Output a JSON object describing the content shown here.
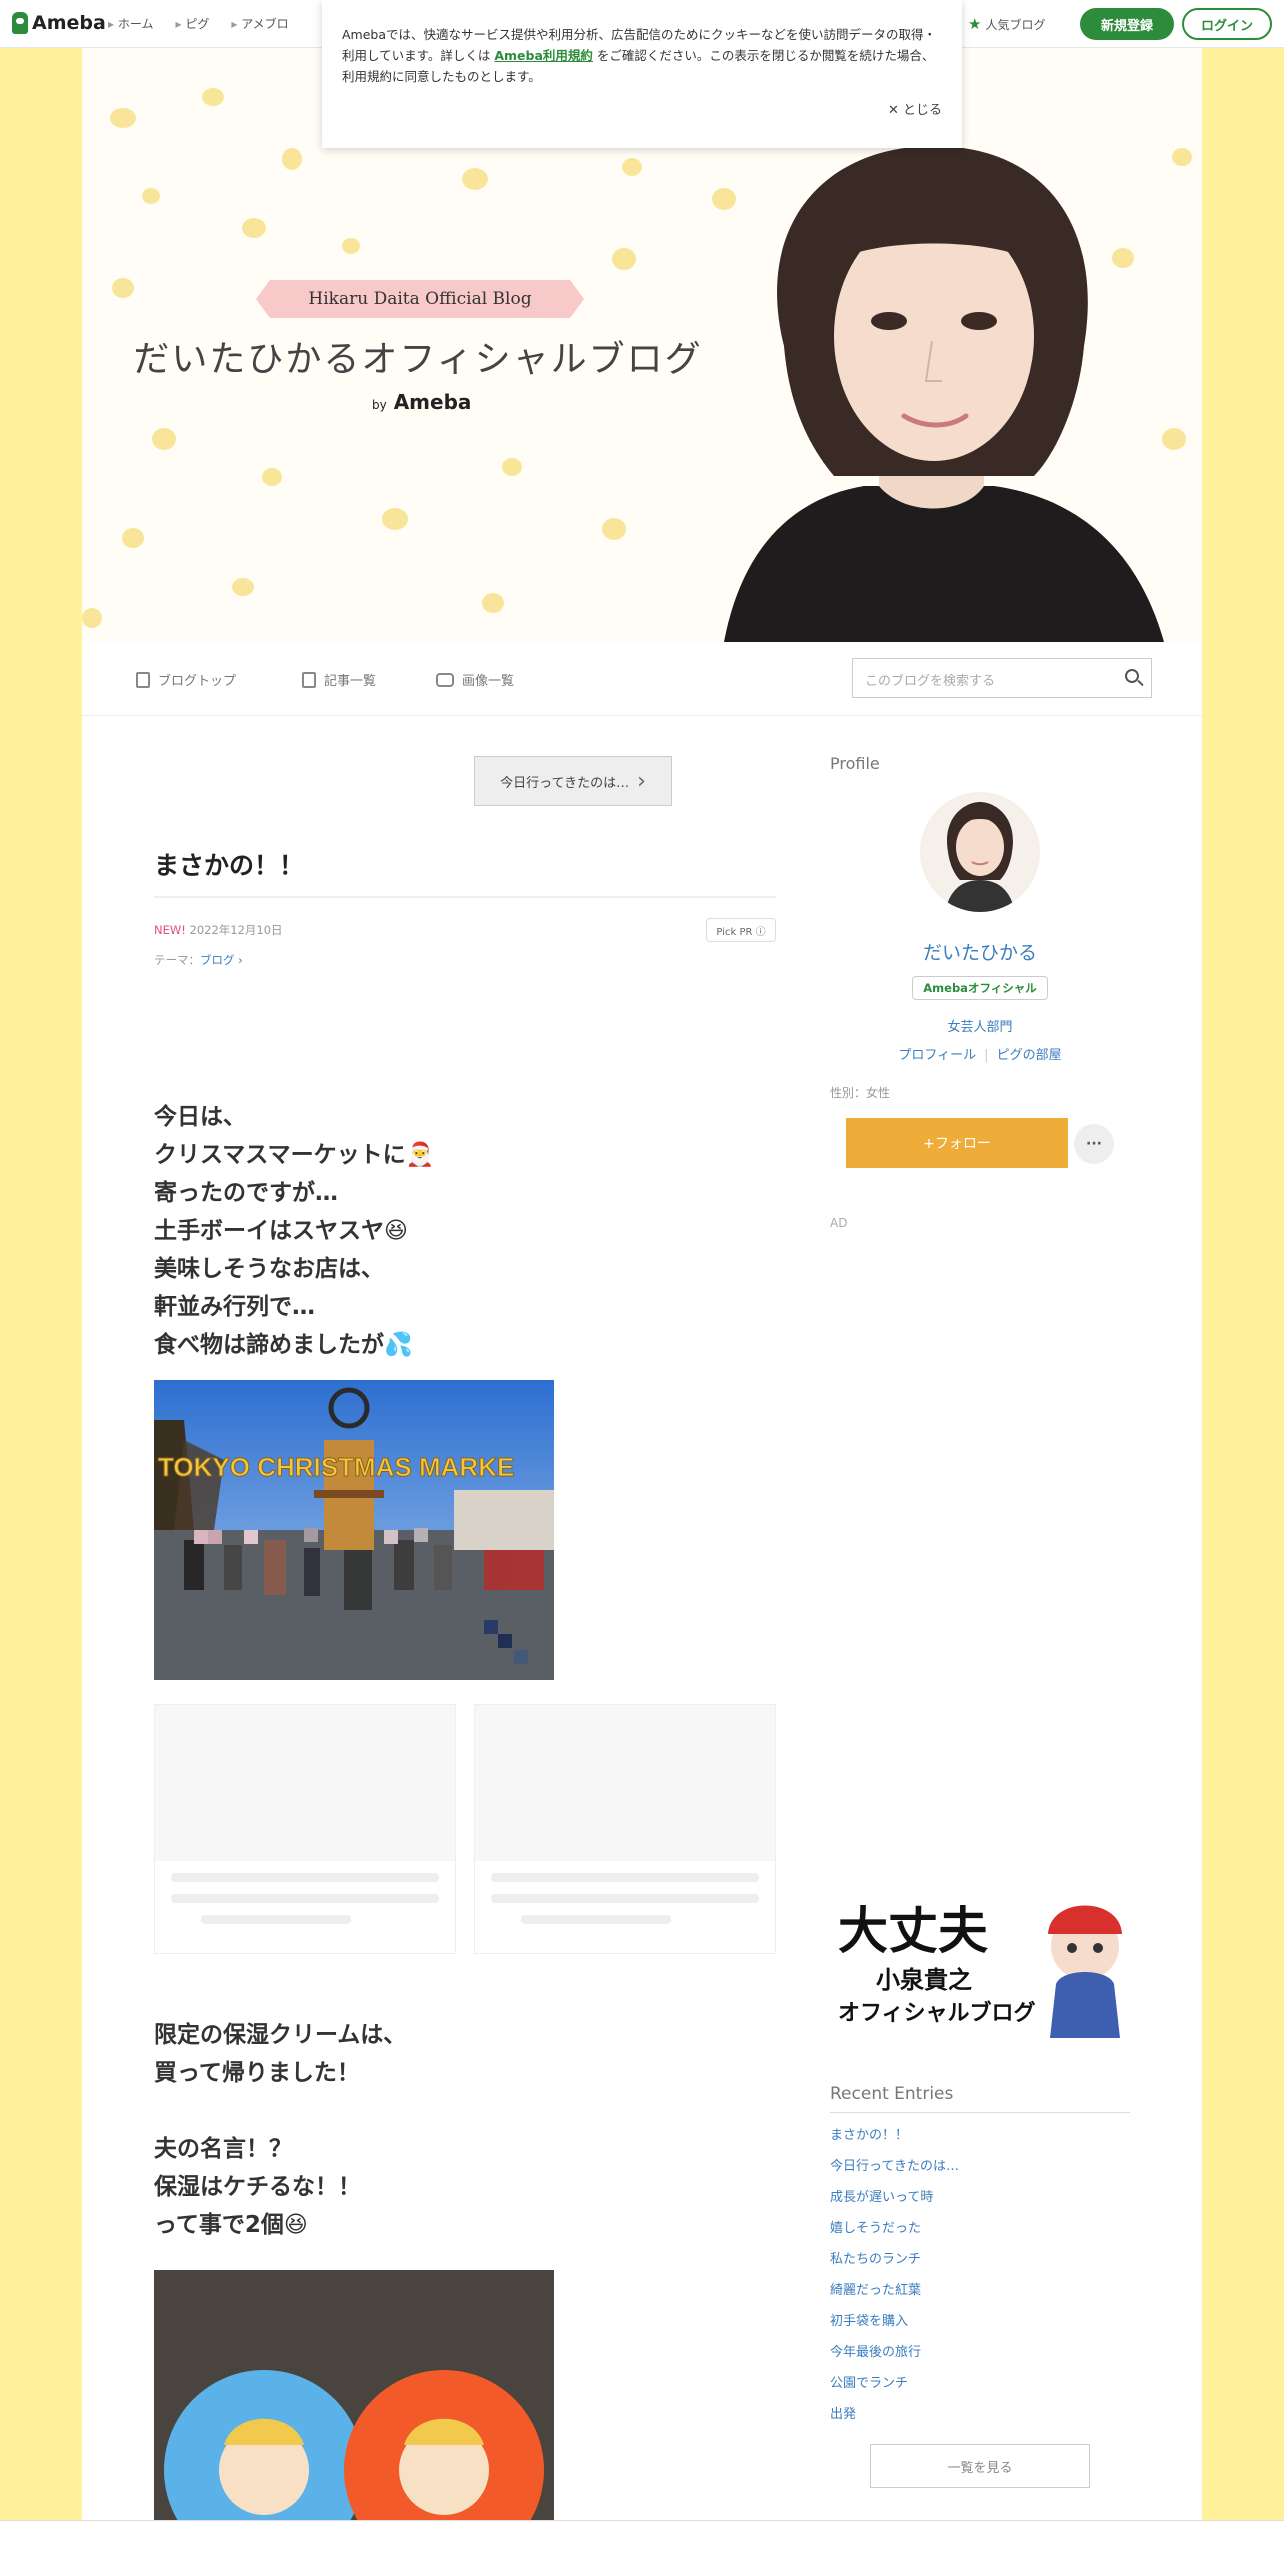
{
  "global_nav": {
    "logo": "Ameba",
    "items": [
      "ホーム",
      "ピグ",
      "アメブロ"
    ],
    "popular_blog": "人気ブログ",
    "signup": "新規登録",
    "login": "ログイン"
  },
  "cookie_notice": {
    "text_before": "Amebaでは、快適なサービス提供や利用分析、広告配信のためにクッキーなどを使い訪問データの取得・利用しています。詳しくは ",
    "link": "Ameba利用規約",
    "text_after": " をご確認ください。この表示を閉じるか閲覧を続けた場合、利用規約に同意したものとします。",
    "close": "✕ とじる"
  },
  "header": {
    "ribbon": "Hikaru Daita Official Blog",
    "title": "だいたひかるオフィシャルブログ",
    "by": "by",
    "brand": "Ameba"
  },
  "blog_nav": {
    "items": [
      "ブログトップ",
      "記事一覧",
      "画像一覧"
    ],
    "search_placeholder": "このブログを検索する"
  },
  "article": {
    "prev_entry": "今日行ってきたのは…",
    "title": "まさかの！！",
    "new_label": "NEW!",
    "date": "2022年12月10日",
    "pick_pr": "Pick PR ⓘ",
    "theme_label": "テーマ：",
    "theme": "ブログ ›",
    "para1": "今日は、\nクリスマスマーケットに🎅\n寄ったのですが…\n土手ボーイはスヤスヤ😆",
    "para2": "美味しそうなお店は、\n軒並み行列で…\n食べ物は諦めましたが💦",
    "photo1_text": "TOKYO CHRISTMAS MARKE",
    "para3": "限定の保湿クリームは、\n買って帰りました！",
    "para4": "夫の名言！？\n保湿はケチるな！！\nって事で2個😆"
  },
  "sidebar": {
    "profile_heading": "Profile",
    "name": "だいたひかる",
    "badge": "Amebaオフィシャル",
    "category": "女芸人部門",
    "link_profile": "プロフィール",
    "link_pig": "ピグの部屋",
    "gender": "性別：女性",
    "follow": "+フォロー",
    "more": "···",
    "ad_label": "AD",
    "banner_line1": "大丈夫",
    "banner_line2": "小泉貴之",
    "banner_line3": "オフィシャルブログ",
    "recent_heading": "Recent Entries",
    "recent": [
      "まさかの！！",
      "今日行ってきたのは…",
      "成長が遅いって時",
      "嬉しそうだった",
      "私たちのランチ",
      "綺麗だった紅葉",
      "初手袋を購入",
      "今年最後の旅行",
      "公園でランチ",
      "出発"
    ],
    "see_all": "一覧を見る"
  },
  "colors": {
    "brand_green": "#2d8c3c",
    "page_yellow": "#fff29a",
    "link_blue": "#3b7dbf",
    "follow_orange": "#eeac38",
    "new_pink": "#e04d86"
  }
}
